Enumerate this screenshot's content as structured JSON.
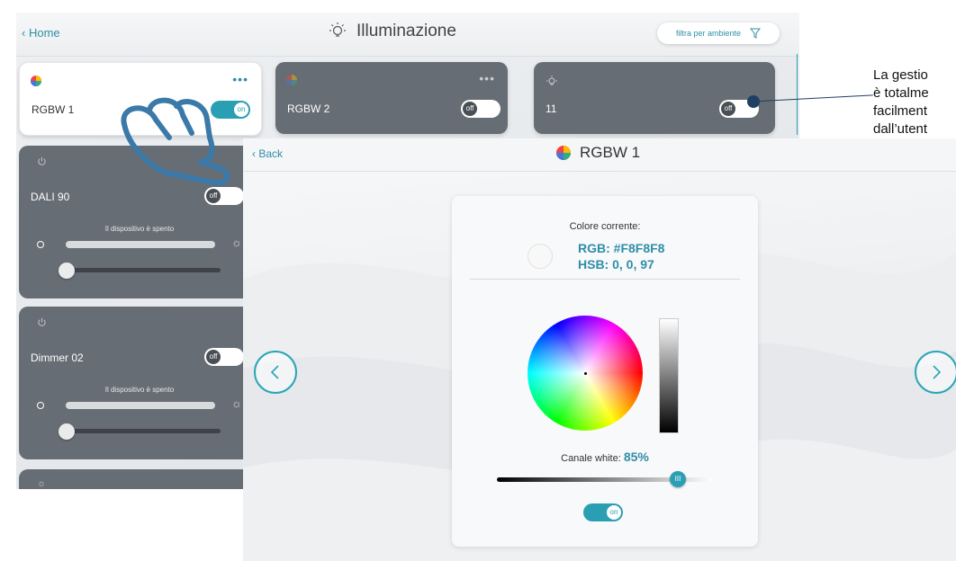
{
  "back_screen": {
    "home_label": "Home",
    "title": "Illuminazione",
    "title_icon": "bulb-icon",
    "filter_label": "filtra per ambiente",
    "filter_icon": "filter-icon",
    "cards": [
      {
        "name": "RGBW 1",
        "toggle": "on",
        "icon": "color-wheel-icon",
        "more": "•••"
      },
      {
        "name": "RGBW 2",
        "toggle": "off",
        "icon": "color-wheel-icon",
        "more": "•••"
      },
      {
        "name": "11",
        "toggle": "off",
        "icon": "bulb-icon"
      }
    ],
    "devices": [
      {
        "name": "DALI 90",
        "toggle": "off",
        "status": "Il dispositivo è spento",
        "icon": "power-icon"
      },
      {
        "name": "Dimmer 02",
        "toggle": "off",
        "status": "Il dispositivo è spento",
        "icon": "power-icon"
      }
    ]
  },
  "side_caption": {
    "line1": "La gestio",
    "line2": "è totalme",
    "line3": "facilment",
    "line4": "dall’utent"
  },
  "front_screen": {
    "back_label": "Back",
    "title": "RGBW 1",
    "title_icon": "color-wheel-icon",
    "current_color_label": "Colore corrente:",
    "rgb": "RGB: #F8F8F8",
    "hsb": "HSB: 0, 0, 97",
    "white_label": "Canale white:",
    "white_value": "85%",
    "white_level": 0.85,
    "thumb_label": "III",
    "toggle": "on",
    "prev_icon": "chevron-left-icon",
    "next_icon": "chevron-right-icon"
  },
  "colors": {
    "accent": "#2a9fb4",
    "card_dark": "#676d74",
    "connector": "#1f3f63"
  }
}
